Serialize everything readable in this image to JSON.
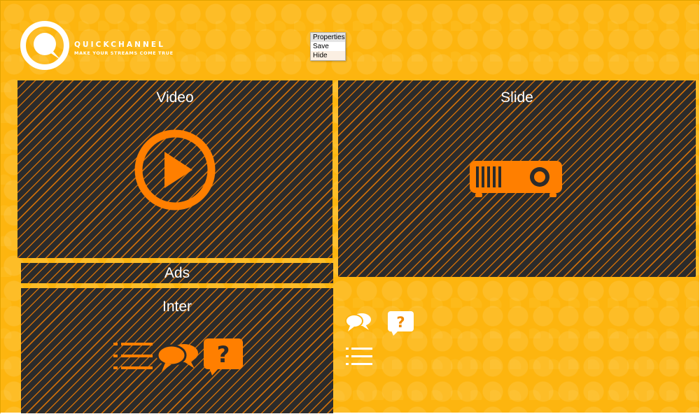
{
  "brand": {
    "name": "QUICKCHANNEL",
    "tagline": "MAKE YOUR STREAMS COME TRUE",
    "logo_icon": "quickchannel-logo-icon"
  },
  "context_menu": {
    "items": [
      {
        "label": "Properties",
        "state": "selected"
      },
      {
        "label": "Save",
        "state": "normal"
      },
      {
        "label": "Hide",
        "state": "hover"
      }
    ]
  },
  "panels": {
    "video": {
      "title": "Video",
      "icon": "play-icon"
    },
    "slide": {
      "title": "Slide",
      "icon": "projector-icon"
    },
    "ads": {
      "title": "Ads"
    },
    "inter": {
      "title": "Inter",
      "icons": [
        "list-icon",
        "chat-icon",
        "question-icon"
      ]
    }
  },
  "toolbox": {
    "icons": [
      "chat-icon",
      "question-icon",
      "list-icon"
    ]
  },
  "colors": {
    "background": "#fdb50f",
    "panel": "#2b2b2b",
    "accent": "#ff7f00",
    "text": "#ffffff"
  }
}
